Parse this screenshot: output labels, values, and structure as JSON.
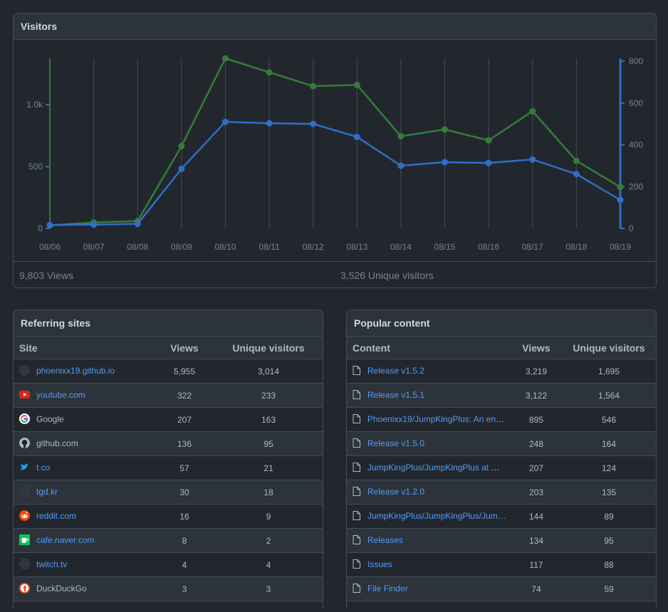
{
  "visitors": {
    "title": "Visitors",
    "views_summary": "9,803 Views",
    "unique_summary": "3,526 Unique visitors"
  },
  "colors": {
    "views": "#347d39",
    "unique": "#316dca",
    "link": "#539bf5"
  },
  "chart_data": {
    "type": "line",
    "x": [
      "08/06",
      "08/07",
      "08/08",
      "08/09",
      "08/10",
      "08/11",
      "08/12",
      "08/13",
      "08/14",
      "08/15",
      "08/16",
      "08/17",
      "08/18",
      "08/19"
    ],
    "series": [
      {
        "axis": "left",
        "color": "#347d39",
        "values": [
          25,
          48,
          60,
          665,
          1375,
          1262,
          1150,
          1160,
          745,
          800,
          712,
          948,
          547,
          335
        ]
      },
      {
        "axis": "right",
        "color": "#316dca",
        "values": [
          16,
          18,
          22,
          285,
          510,
          503,
          500,
          438,
          300,
          317,
          313,
          330,
          260,
          136
        ]
      }
    ],
    "left_axis": {
      "ticks": [
        "0",
        "500",
        "1.0k"
      ],
      "tick_values": [
        0,
        500,
        1000
      ],
      "range": [
        0,
        1375
      ]
    },
    "right_axis": {
      "ticks": [
        "0",
        "200",
        "400",
        "600",
        "800"
      ],
      "tick_values": [
        0,
        200,
        400,
        600,
        800
      ],
      "range": [
        0,
        800
      ]
    },
    "grid": "vertical"
  },
  "referring": {
    "title": "Referring sites",
    "columns": [
      "Site",
      "Views",
      "Unique visitors"
    ],
    "rows": [
      {
        "site": "phoenixx19.github.io",
        "views": "5,955",
        "unique": "3,014",
        "icon": "globe-icon",
        "link": true
      },
      {
        "site": "youtube.com",
        "views": "322",
        "unique": "233",
        "icon": "youtube-icon",
        "link": true
      },
      {
        "site": "Google",
        "views": "207",
        "unique": "163",
        "icon": "google-icon",
        "link": false
      },
      {
        "site": "github.com",
        "views": "136",
        "unique": "95",
        "icon": "github-icon",
        "link": false
      },
      {
        "site": "t.co",
        "views": "57",
        "unique": "21",
        "icon": "twitter-icon",
        "link": true
      },
      {
        "site": "tgd.kr",
        "views": "30",
        "unique": "18",
        "icon": "globe-icon",
        "link": true
      },
      {
        "site": "reddit.com",
        "views": "16",
        "unique": "9",
        "icon": "reddit-icon",
        "link": true
      },
      {
        "site": "cafe.naver.com",
        "views": "8",
        "unique": "2",
        "icon": "naver-cafe-icon",
        "link": true
      },
      {
        "site": "twitch.tv",
        "views": "4",
        "unique": "4",
        "icon": "globe-icon",
        "link": true
      },
      {
        "site": "DuckDuckGo",
        "views": "3",
        "unique": "3",
        "icon": "duckduckgo-icon",
        "link": false
      }
    ]
  },
  "popular": {
    "title": "Popular content",
    "columns": [
      "Content",
      "Views",
      "Unique visitors"
    ],
    "rows": [
      {
        "content": "Release v1.5.2",
        "views": "3,219",
        "unique": "1,695"
      },
      {
        "content": "Release v1.5.1",
        "views": "3,122",
        "unique": "1,564"
      },
      {
        "content": "Phoenixx19/JumpKingPlus: An enh…",
        "views": "895",
        "unique": "546"
      },
      {
        "content": "Release v1.5.0",
        "views": "248",
        "unique": "164"
      },
      {
        "content": "JumpKingPlus/JumpKingPlus at m…",
        "views": "207",
        "unique": "124"
      },
      {
        "content": "Release v1.2.0",
        "views": "203",
        "unique": "135"
      },
      {
        "content": "JumpKingPlus/JumpKingPlus/Jum…",
        "views": "144",
        "unique": "89"
      },
      {
        "content": "Releases",
        "views": "134",
        "unique": "95"
      },
      {
        "content": "Issues",
        "views": "117",
        "unique": "88"
      },
      {
        "content": "File Finder",
        "views": "74",
        "unique": "59"
      }
    ]
  }
}
